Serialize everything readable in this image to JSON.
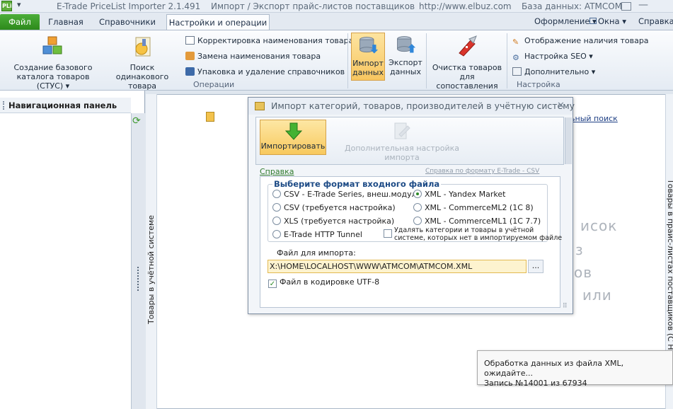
{
  "app": {
    "logo_text": "PLi",
    "title": "E-Trade PriceList Importer 2.1.491",
    "subtitle": "Импорт / Экспорт прайс-листов поставщиков",
    "url": "http://www.elbuz.com",
    "database": "База данных: ATMCOM"
  },
  "tabs": {
    "file": "Файл",
    "home": "Главная",
    "refs": "Справочники",
    "settings_ops": "Настройки и операции"
  },
  "menu_right": {
    "appearance": "Оформление",
    "windows": "Окна",
    "help": "Справка"
  },
  "ribbon": {
    "create_base_catalog": [
      "Создание базового",
      "каталога товаров (СТУС)"
    ],
    "find_same_product": [
      "Поиск одинакового",
      "товара"
    ],
    "correct_names": "Корректировка наименования товара",
    "replace_names": "Замена наименования товара",
    "pack_remove_refs": "Упаковка и удаление справочников",
    "group_operations": "Операции",
    "import_data": [
      "Импорт",
      "данных"
    ],
    "export_data": [
      "Экспорт",
      "данных"
    ],
    "clean_products": [
      "Очистка товаров",
      "для сопоставления"
    ],
    "show_availability": "Отображение наличия товара",
    "seo_settings": "Настройка SEO",
    "additional": "Дополнительно",
    "group_settings": "Настройка"
  },
  "nav": {
    "title": "Навигационная панель"
  },
  "main": {
    "left_vertical_tab": "Товары в учётной системе",
    "right_vertical_tab": "Товары в прайс-листах поставщиков (С НПП)",
    "search_link_fragment": "льный поиск",
    "bg_words": [
      "исок",
      "з",
      "ов",
      "или"
    ]
  },
  "dialog": {
    "title": "Импорт категорий, товаров, производителей в учётную систему",
    "import_button": "Импортировать",
    "advanced_button": "Дополнительная настройка импорта",
    "help_link": "Справка",
    "format_help_link": "Справка по формату E-Trade - CSV",
    "format_group_title": "Выберите формат входного файла",
    "options": [
      "CSV - E-Trade Series, внеш.модуль",
      "CSV (требуется настройка)",
      "XLS (требуется настройка)",
      "E-Trade HTTP Tunnel",
      "XML - Yandex Market",
      "XML - CommerceML2 (1C 8)",
      "XML - CommerceML1 (1C 7.7)"
    ],
    "selected_option": "XML - Yandex Market",
    "delete_missing": [
      "Удалять категории и товары в учётной",
      "системе, которых нет в импортируемом файле"
    ],
    "file_label": "Файл для импорта:",
    "file_value": "X:\\HOME\\LOCALHOST\\WWW\\ATMCOM\\ATMCOM.XML",
    "browse_label": "...",
    "utf8_label": "Файл в кодировке UTF-8",
    "utf8_checked": true
  },
  "toast": {
    "line1": "Обработка данных из файла XML, ожидайте...",
    "line2": "Запись №14001 из 67934"
  }
}
